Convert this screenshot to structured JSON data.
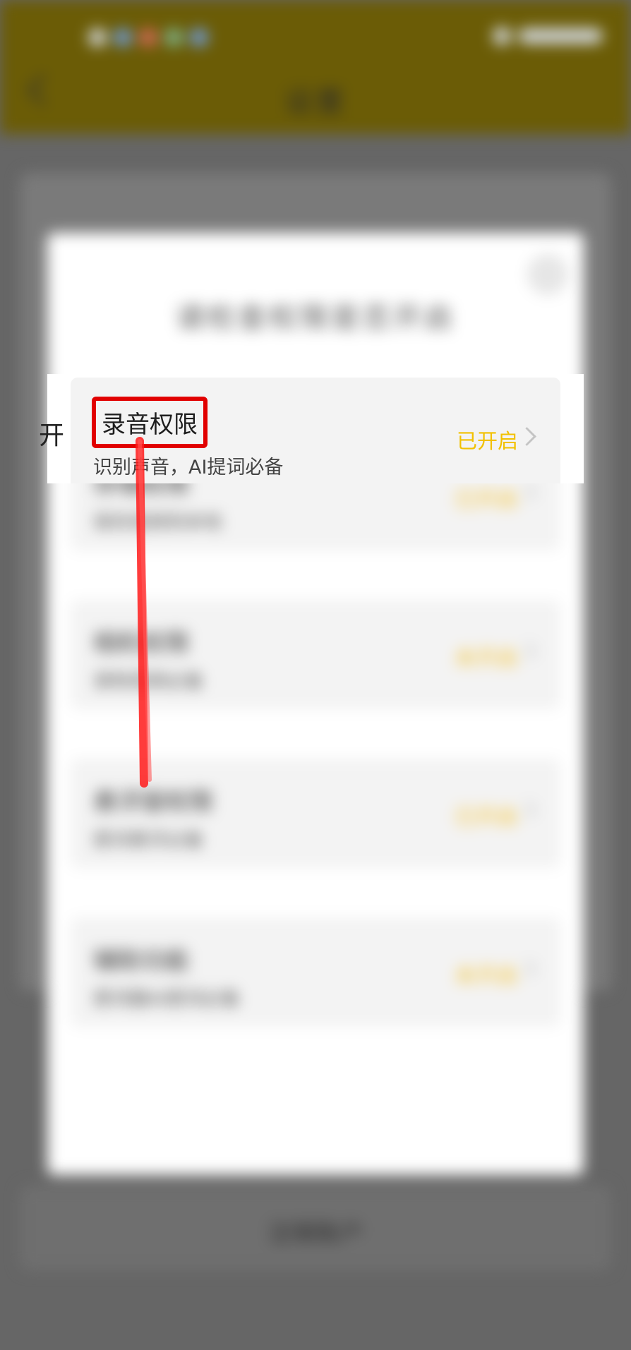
{
  "status_bar": {
    "color": "#6b5c06"
  },
  "nav": {
    "title": "设置"
  },
  "background": {
    "rows": [
      "",
      "",
      "",
      "",
      "",
      ""
    ],
    "left_edge_char": "开",
    "logout_label": "注销账户"
  },
  "dialog": {
    "title": "请检查权限是否开启",
    "permissions": [
      {
        "name": "录音权限",
        "desc": "识别声音，AI提词必备",
        "status": "已开启",
        "focused": true
      },
      {
        "name": "存储权限",
        "desc": "保存视频到本地",
        "status": "已开启"
      },
      {
        "name": "相机权限",
        "desc": "录制视频必备",
        "status": "未开启"
      },
      {
        "name": "悬浮窗权限",
        "desc": "提词悬浮必备",
        "status": "已开启"
      },
      {
        "name": "辅助功能",
        "tag": "",
        "desc": "提词器AI提词必备",
        "status": "未开启"
      }
    ]
  },
  "annotation": {
    "highlight_color": "#e10000"
  }
}
